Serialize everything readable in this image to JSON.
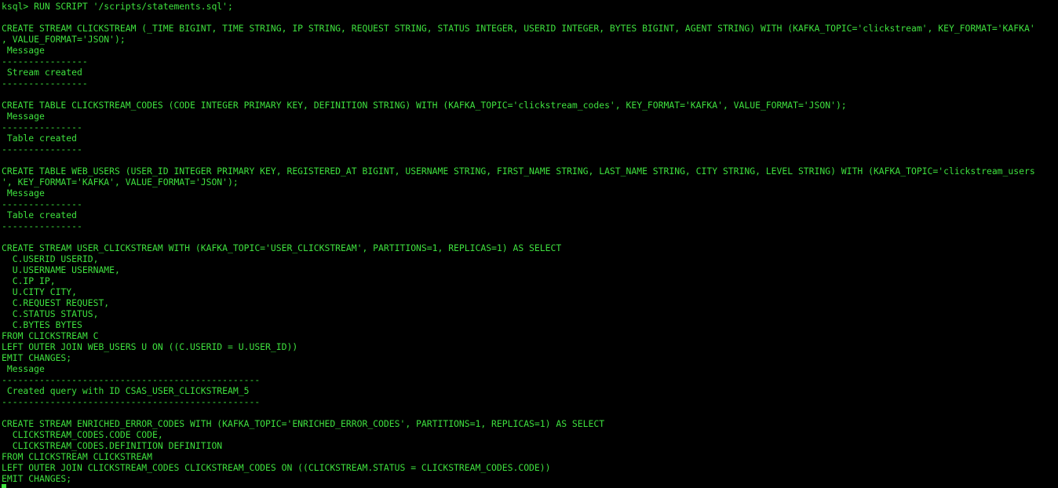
{
  "terminal": {
    "text_color": "#3ee03e",
    "background_color": "#000000",
    "lines": [
      "ksql> RUN SCRIPT '/scripts/statements.sql';",
      "",
      "CREATE STREAM CLICKSTREAM (_TIME BIGINT, TIME STRING, IP STRING, REQUEST STRING, STATUS INTEGER, USERID INTEGER, BYTES BIGINT, AGENT STRING) WITH (KAFKA_TOPIC='clickstream', KEY_FORMAT='KAFKA'",
      ", VALUE_FORMAT='JSON');",
      " Message",
      "----------------",
      " Stream created",
      "----------------",
      "",
      "CREATE TABLE CLICKSTREAM_CODES (CODE INTEGER PRIMARY KEY, DEFINITION STRING) WITH (KAFKA_TOPIC='clickstream_codes', KEY_FORMAT='KAFKA', VALUE_FORMAT='JSON');",
      " Message",
      "---------------",
      " Table created",
      "---------------",
      "",
      "CREATE TABLE WEB_USERS (USER_ID INTEGER PRIMARY KEY, REGISTERED_AT BIGINT, USERNAME STRING, FIRST_NAME STRING, LAST_NAME STRING, CITY STRING, LEVEL STRING) WITH (KAFKA_TOPIC='clickstream_users",
      "', KEY_FORMAT='KAFKA', VALUE_FORMAT='JSON');",
      " Message",
      "---------------",
      " Table created",
      "---------------",
      "",
      "CREATE STREAM USER_CLICKSTREAM WITH (KAFKA_TOPIC='USER_CLICKSTREAM', PARTITIONS=1, REPLICAS=1) AS SELECT",
      "  C.USERID USERID,",
      "  U.USERNAME USERNAME,",
      "  C.IP IP,",
      "  U.CITY CITY,",
      "  C.REQUEST REQUEST,",
      "  C.STATUS STATUS,",
      "  C.BYTES BYTES",
      "FROM CLICKSTREAM C",
      "LEFT OUTER JOIN WEB_USERS U ON ((C.USERID = U.USER_ID))",
      "EMIT CHANGES;",
      " Message",
      "------------------------------------------------",
      " Created query with ID CSAS_USER_CLICKSTREAM_5",
      "------------------------------------------------",
      "",
      "CREATE STREAM ENRICHED_ERROR_CODES WITH (KAFKA_TOPIC='ENRICHED_ERROR_CODES', PARTITIONS=1, REPLICAS=1) AS SELECT",
      "  CLICKSTREAM_CODES.CODE CODE,",
      "  CLICKSTREAM_CODES.DEFINITION DEFINITION",
      "FROM CLICKSTREAM CLICKSTREAM",
      "LEFT OUTER JOIN CLICKSTREAM_CODES CLICKSTREAM_CODES ON ((CLICKSTREAM.STATUS = CLICKSTREAM_CODES.CODE))",
      "EMIT CHANGES;"
    ]
  }
}
